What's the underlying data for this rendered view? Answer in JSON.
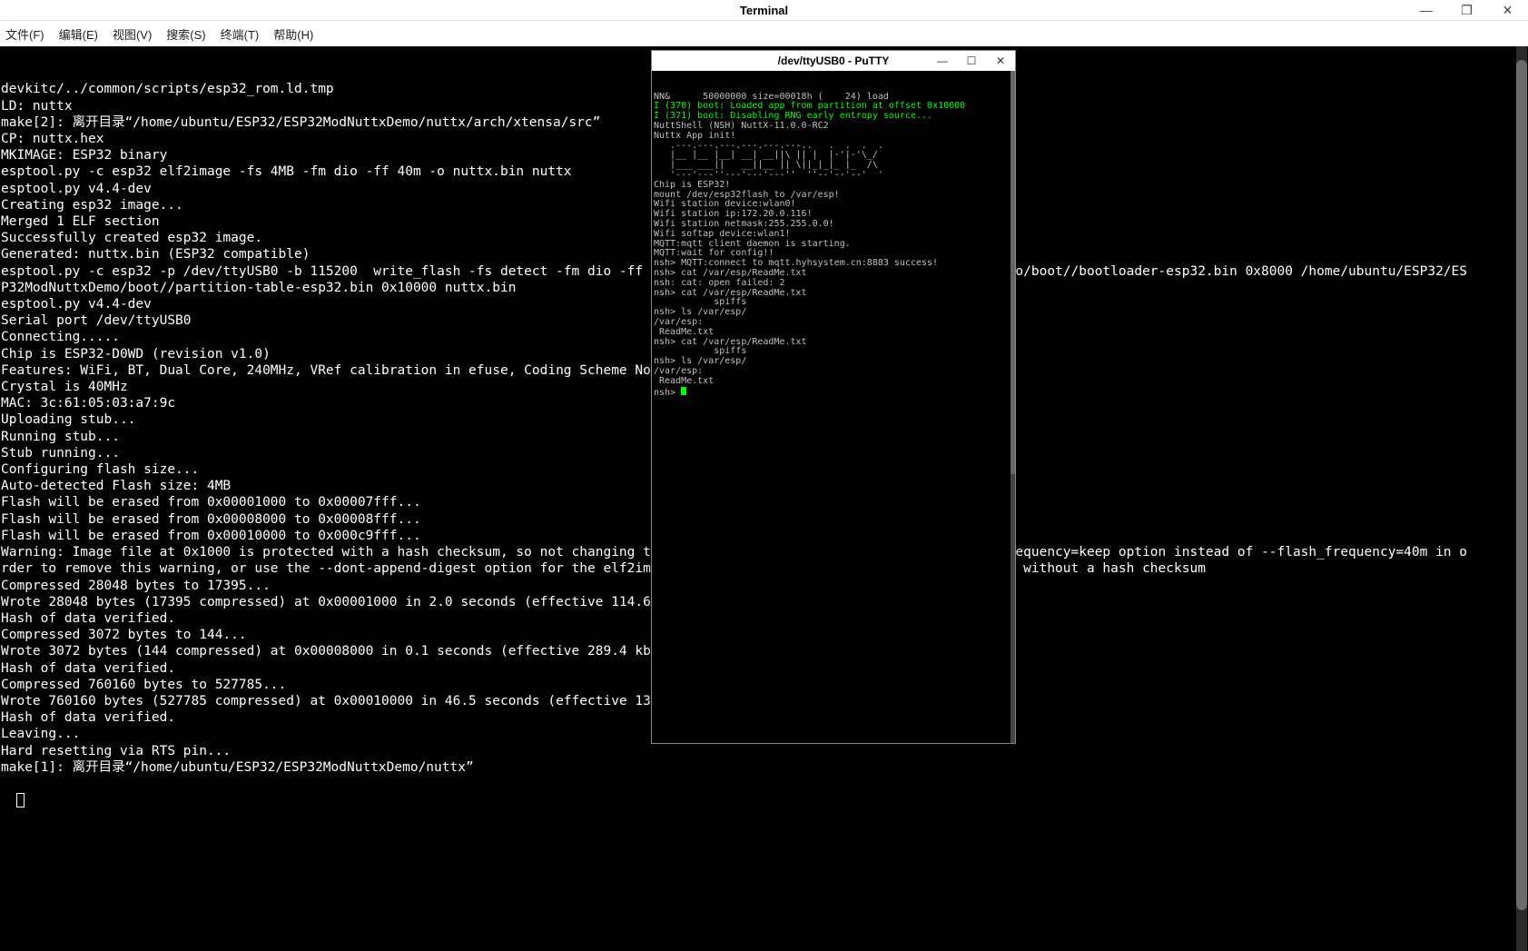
{
  "window": {
    "title": "Terminal",
    "min": "—",
    "max": "❐",
    "close": "✕"
  },
  "menu": {
    "file": "文件(F)",
    "edit": "编辑(E)",
    "view": "视图(V)",
    "search": "搜索(S)",
    "terminal": "终端(T)",
    "help": "帮助(H)"
  },
  "terminal_lines": [
    "devkitc/../common/scripts/esp32_rom.ld.tmp",
    "LD: nuttx",
    "make[2]: 离开目录“/home/ubuntu/ESP32/ESP32ModNuttxDemo/nuttx/arch/xtensa/src”",
    "CP: nuttx.hex",
    "MKIMAGE: ESP32 binary",
    "esptool.py -c esp32 elf2image -fs 4MB -fm dio -ff 40m -o nuttx.bin nuttx",
    "esptool.py v4.4-dev",
    "Creating esp32 image...",
    "Merged 1 ELF section",
    "Successfully created esp32 image.",
    "Generated: nuttx.bin (ESP32 compatible)",
    "esptool.py -c esp32 -p /dev/ttyUSB0 -b 115200  write_flash -fs detect -fm dio -ff 40m 0x1000 /home/ubuntu/ESP32/ESP32ModNuttxDemo/boot//bootloader-esp32.bin 0x8000 /home/ubuntu/ESP32/ES",
    "P32ModNuttxDemo/boot//partition-table-esp32.bin 0x10000 nuttx.bin",
    "esptool.py v4.4-dev",
    "Serial port /dev/ttyUSB0",
    "Connecting.....",
    "Chip is ESP32-D0WD (revision v1.0)",
    "Features: WiFi, BT, Dual Core, 240MHz, VRef calibration in efuse, Coding Scheme None",
    "Crystal is 40MHz",
    "MAC: 3c:61:05:03:a7:9c",
    "Uploading stub...",
    "Running stub...",
    "Stub running...",
    "Configuring flash size...",
    "Auto-detected Flash size: 4MB",
    "Flash will be erased from 0x00001000 to 0x00007fff...",
    "Flash will be erased from 0x00008000 to 0x00008fff...",
    "Flash will be erased from 0x00010000 to 0x000c9fff...",
    "Warning: Image file at 0x1000 is protected with a hash checksum, so not changing the flash frequency setting. Use the --flash_frequency=keep option instead of --flash_frequency=40m in o",
    "rder to remove this warning, or use the --dont-append-digest option for the elf2image command in order to generate an image file without a hash checksum",
    "Compressed 28048 bytes to 17395...",
    "Wrote 28048 bytes (17395 compressed) at 0x00001000 in 2.0 seconds (effective 114.6 kbit/s)...",
    "Hash of data verified.",
    "Compressed 3072 bytes to 144...",
    "Wrote 3072 bytes (144 compressed) at 0x00008000 in 0.1 seconds (effective 289.4 kbit/s)...",
    "Hash of data verified.",
    "Compressed 760160 bytes to 527785...",
    "Wrote 760160 bytes (527785 compressed) at 0x00010000 in 46.5 seconds (effective 130.7 kbit/s)...",
    "Hash of data verified.",
    "",
    "Leaving...",
    "Hard resetting via RTS pin...",
    "make[1]: 离开目录“/home/ubuntu/ESP32/ESP32ModNuttxDemo/nuttx”"
  ],
  "putty": {
    "title": "/dev/ttyUSB0 - PuTTY",
    "min": "—",
    "max": "☐",
    "close": "✕",
    "lines": [
      {
        "c": "grey",
        "t": "NN&      50000000 size=00018h (    24) load"
      },
      {
        "c": "green",
        "t": "I (370) boot: Loaded app from partition at offset 0x10000"
      },
      {
        "c": "green",
        "t": "I (371) boot: Disabling RNG early entropy source..."
      },
      {
        "c": "grey",
        "t": ""
      },
      {
        "c": "grey",
        "t": "NuttShell (NSH) NuttX-11.0.0-RC2"
      },
      {
        "c": "grey",
        "t": "Nuttx App init!"
      },
      {
        "c": "grey",
        "t": ""
      },
      {
        "c": "grey",
        "t": "   .---.---.---.---.---.---..   .  .  .  .  "
      },
      {
        "c": "grey",
        "t": "   |__ |__ |__| __| __||\\ || |  |-'|-'\\_/   "
      },
      {
        "c": "grey",
        "t": "   |___ ___||   __||__ || \\||_|_|_ |_  /\\   "
      },
      {
        "c": "grey",
        "t": "   '---'---''---'---'---''  ''--'--'--'  '  "
      },
      {
        "c": "grey",
        "t": ""
      },
      {
        "c": "grey",
        "t": ""
      },
      {
        "c": "grey",
        "t": "Chip is ESP32!"
      },
      {
        "c": "grey",
        "t": "mount /dev/esp32flash to /var/esp!"
      },
      {
        "c": "grey",
        "t": "Wifi station device:wlan0!"
      },
      {
        "c": "grey",
        "t": "Wifi station ip:172.20.0.116!"
      },
      {
        "c": "grey",
        "t": "Wifi station netmask:255.255.0.0!"
      },
      {
        "c": "grey",
        "t": "Wifi softap device:wlan1!"
      },
      {
        "c": "grey",
        "t": "MQTT:mqtt client daemon is starting."
      },
      {
        "c": "grey",
        "t": "MQTT:wait for config!!"
      },
      {
        "c": "grey",
        "t": "nsh> MQTT:connect to mqtt.hyhsystem.cn:8883 success!"
      },
      {
        "c": "grey",
        "t": ""
      },
      {
        "c": "grey",
        "t": "nsh> cat /var/esp/ReadMe.txt"
      },
      {
        "c": "grey",
        "t": "nsh: cat: open failed: 2"
      },
      {
        "c": "grey",
        "t": "nsh> cat /var/esp/ReadMe.txt"
      },
      {
        "c": "grey",
        "t": "           spiffs"
      },
      {
        "c": "grey",
        "t": "nsh> ls /var/esp/"
      },
      {
        "c": "grey",
        "t": "/var/esp:"
      },
      {
        "c": "grey",
        "t": " ReadMe.txt"
      },
      {
        "c": "grey",
        "t": "nsh> cat /var/esp/ReadMe.txt"
      },
      {
        "c": "grey",
        "t": "           spiffs"
      },
      {
        "c": "grey",
        "t": "nsh> ls /var/esp/"
      },
      {
        "c": "grey",
        "t": "/var/esp:"
      },
      {
        "c": "grey",
        "t": " ReadMe.txt"
      },
      {
        "c": "grey",
        "t": "nsh> "
      }
    ]
  }
}
